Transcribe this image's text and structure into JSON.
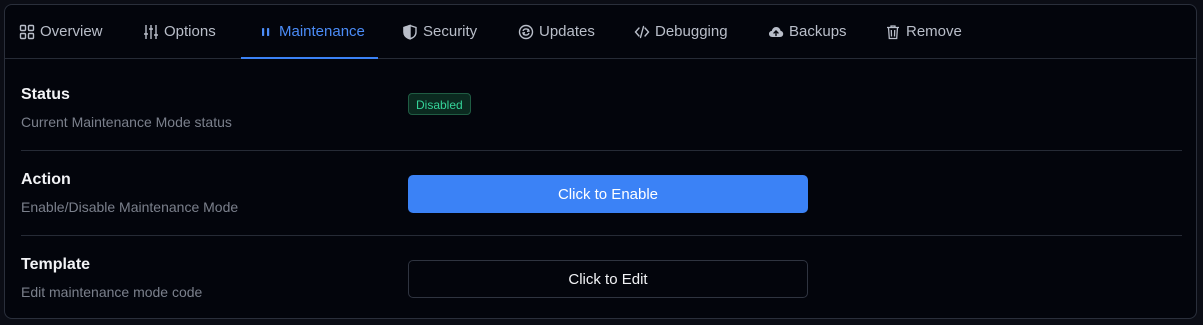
{
  "tabs": [
    {
      "label": "Overview",
      "icon": "overview-grid-icon",
      "active": false
    },
    {
      "label": "Options",
      "icon": "sliders-icon",
      "active": false
    },
    {
      "label": "Maintenance",
      "icon": "pause-icon",
      "active": true
    },
    {
      "label": "Security",
      "icon": "shield-icon",
      "active": false
    },
    {
      "label": "Updates",
      "icon": "refresh-icon",
      "active": false
    },
    {
      "label": "Debugging",
      "icon": "code-icon",
      "active": false
    },
    {
      "label": "Backups",
      "icon": "cloud-upload-icon",
      "active": false
    },
    {
      "label": "Remove",
      "icon": "trash-icon",
      "active": false
    }
  ],
  "status": {
    "label": "Status",
    "description": "Current Maintenance Mode status",
    "badge": "Disabled"
  },
  "action": {
    "label": "Action",
    "description": "Enable/Disable Maintenance Mode",
    "button": "Click to Enable"
  },
  "template": {
    "label": "Template",
    "description": "Edit maintenance mode code",
    "button": "Click to Edit"
  },
  "colors": {
    "accent": "#3b82f6",
    "badge_text": "#34d399",
    "background": "#03050c"
  }
}
